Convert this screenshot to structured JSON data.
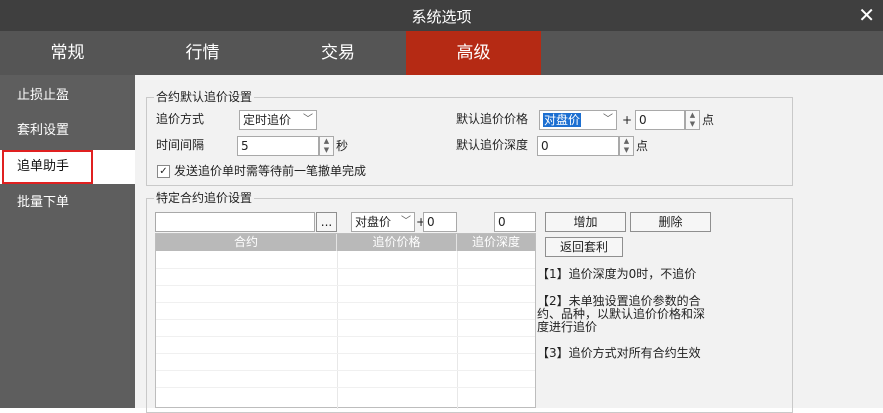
{
  "window": {
    "title": "系统选项",
    "close_glyph": "✕"
  },
  "tabs": [
    {
      "label": "常规"
    },
    {
      "label": "行情"
    },
    {
      "label": "交易"
    },
    {
      "label": "高级",
      "active": true
    }
  ],
  "sidebar": {
    "items": [
      {
        "label": "止损止盈"
      },
      {
        "label": "套利设置"
      },
      {
        "label": "追单助手",
        "active": true
      },
      {
        "label": "批量下单"
      }
    ]
  },
  "default_settings": {
    "legend": "合约默认追价设置",
    "method_label": "追价方式",
    "method_value": "定时追价",
    "interval_label": "时间间隔",
    "interval_value": "5",
    "interval_unit": "秒",
    "price_label": "默认追价价格",
    "price_value": "对盘价",
    "plus": "+",
    "price_offset": "0",
    "price_unit": "点",
    "depth_label": "默认追价深度",
    "depth_value": "0",
    "depth_unit": "点",
    "wait_checkbox_label": "发送追价单时需等待前一笔撤单完成",
    "wait_checked": true
  },
  "specific_settings": {
    "legend": "特定合约追价设置",
    "contract_value": "",
    "browse_label": "...",
    "price_value": "对盘价",
    "plus": "+",
    "offset_value": "0",
    "depth_value": "0",
    "add_button": "增加",
    "delete_button": "删除",
    "back_button": "返回套利",
    "columns": [
      "合约",
      "追价价格",
      "追价深度"
    ],
    "notes": [
      "【1】追价深度为0时，不追价",
      "【2】未单独设置追价参数的合",
      "约、品种，以默认追价价格和深",
      "度进行追价",
      "【3】追价方式对所有合约生效"
    ]
  },
  "colors": {
    "accent": "#b52a14",
    "titlebar": "#3f3f3f",
    "tabbar": "#555555",
    "sidebar": "#5e5e5e",
    "highlight_border": "#e02020"
  }
}
